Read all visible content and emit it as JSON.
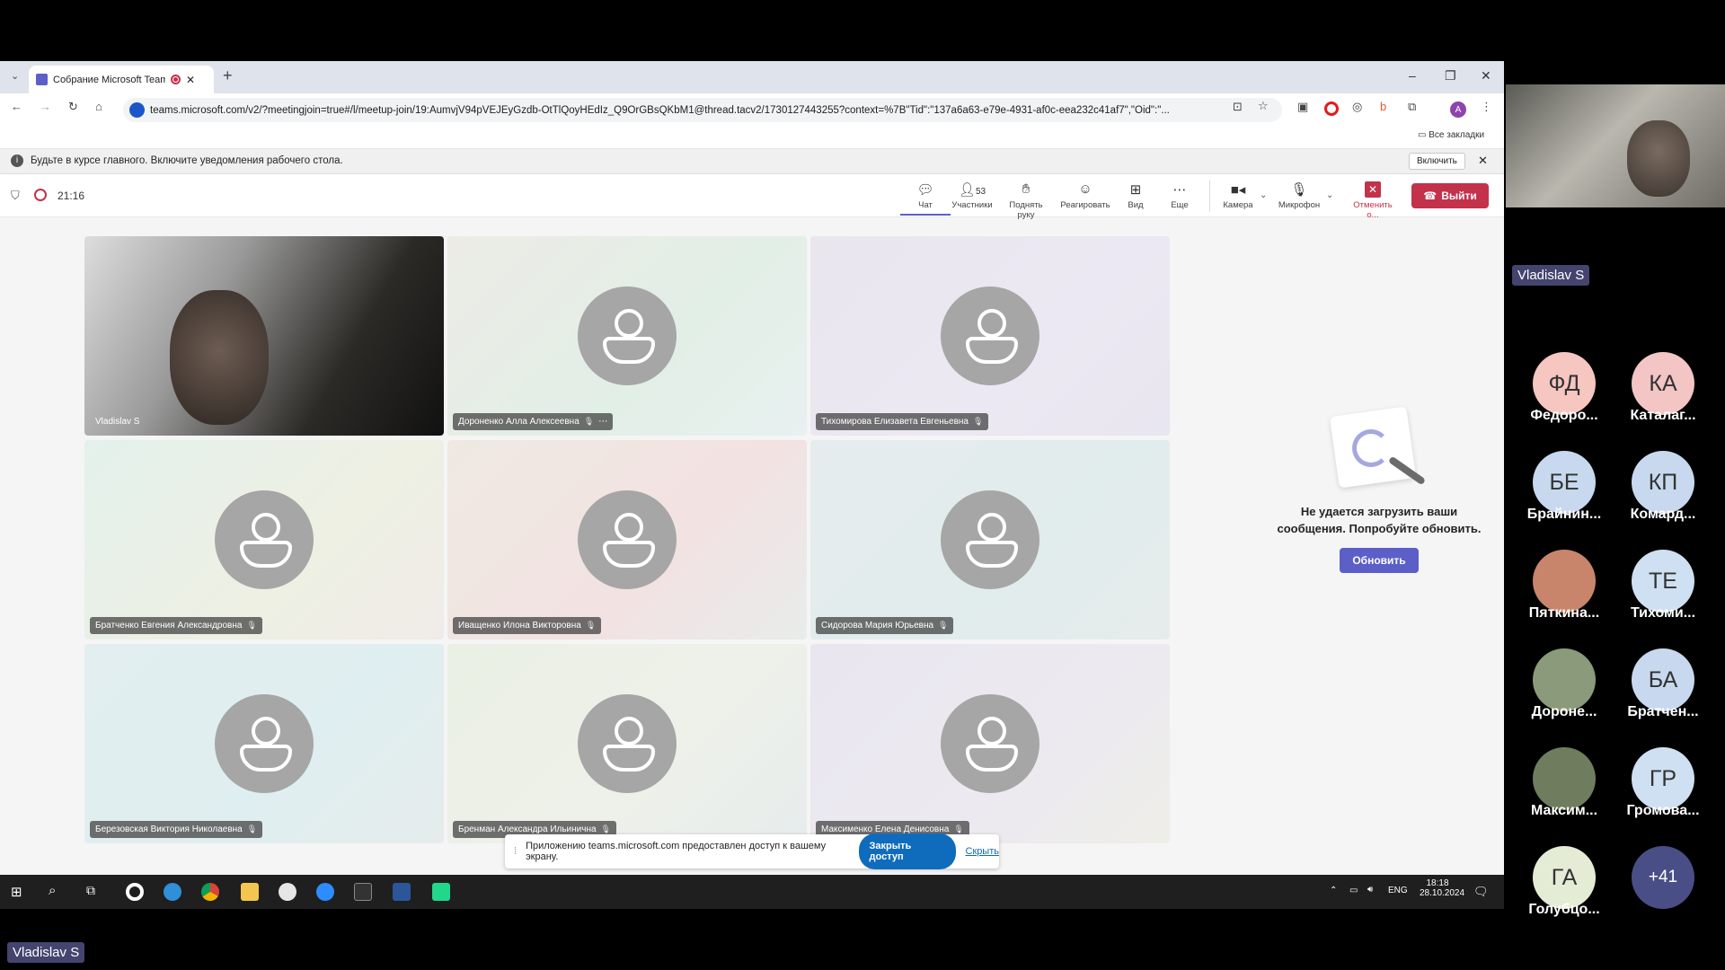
{
  "browser": {
    "tab_title": "Собрание Microsoft Teams",
    "url": "teams.microsoft.com/v2/?meetingjoin=true#/l/meetup-join/19:AumvjV94pVEJEyGzdb-OtTlQoyHEdIz_Q9OrGBsQKbM1@thread.tacv2/1730127443255?context=%7B\"Tid\":\"137a6a63-e79e-4931-af0c-eea232c41af7\",\"Oid\":\"...",
    "profile_initial": "A",
    "bookmarks_label": "Все закладки"
  },
  "notification": {
    "text": "Будьте в курсе главного. Включите уведомления рабочего стола.",
    "enable_label": "Включить"
  },
  "meeting": {
    "timer": "21:16",
    "toolbar": {
      "chat": "Чат",
      "participants": "Участники",
      "participants_count": "53",
      "raise_hand": "Поднять руку",
      "react": "Реагировать",
      "view": "Вид",
      "more": "Еще",
      "camera": "Камера",
      "mic": "Микрофон",
      "stop_share": "Отменить о...",
      "leave": "Выйти"
    },
    "tiles": [
      {
        "name": "Vladislav S"
      },
      {
        "name": "Дороненко Алла Алексеевна"
      },
      {
        "name": "Тихомирова Елизавета Евгеньевна"
      },
      {
        "name": "Братченко Евгения Александровна"
      },
      {
        "name": "Иващенко Илона Викторовна"
      },
      {
        "name": "Сидорова Мария Юрьевна"
      },
      {
        "name": "Березовская Виктория Николаевна"
      },
      {
        "name": "Бренман Александра Ильинична"
      },
      {
        "name": "Максименко Елена Денисовна"
      }
    ],
    "side_panel": {
      "error": "Не удается загрузить ваши сообщения. Попробуйте обновить.",
      "refresh_label": "Обновить"
    },
    "share_banner": {
      "text": "Приложению teams.microsoft.com предоставлен доступ к вашему экрану.",
      "stop_label": "Закрыть доступ",
      "hide_label": "Скрыть"
    }
  },
  "taskbar": {
    "lang": "ENG",
    "time": "18:18",
    "date": "28.10.2024"
  },
  "strip": {
    "self_name": "Vladislav S",
    "bottom_name": "Vladislav S",
    "participants": [
      {
        "initials": "ФД",
        "label": "Федоро...",
        "color": "#f6c6c0"
      },
      {
        "initials": "КА",
        "label": "Каталаг...",
        "color": "#f3c5c5"
      },
      {
        "initials": "БЕ",
        "label": "Брайнин...",
        "color": "#c8d9ef"
      },
      {
        "initials": "КП",
        "label": "Комард...",
        "color": "#c8d9ef"
      },
      {
        "initials": "",
        "label": "Пяткина...",
        "color": "#c9856b"
      },
      {
        "initials": "ТЕ",
        "label": "Тихоми...",
        "color": "#cfe0f2"
      },
      {
        "initials": "",
        "label": "Дороне...",
        "color": "#8a9a7a"
      },
      {
        "initials": "БА",
        "label": "Братчен...",
        "color": "#c8d9ef"
      },
      {
        "initials": "",
        "label": "Максим...",
        "color": "#6f7d5e"
      },
      {
        "initials": "ГР",
        "label": "Громова...",
        "color": "#cfe0f2"
      },
      {
        "initials": "ГА",
        "label": "Голубцо...",
        "color": "#e4ecd6"
      },
      {
        "initials": "+41",
        "label": "",
        "color": "#4a4e86"
      }
    ]
  }
}
